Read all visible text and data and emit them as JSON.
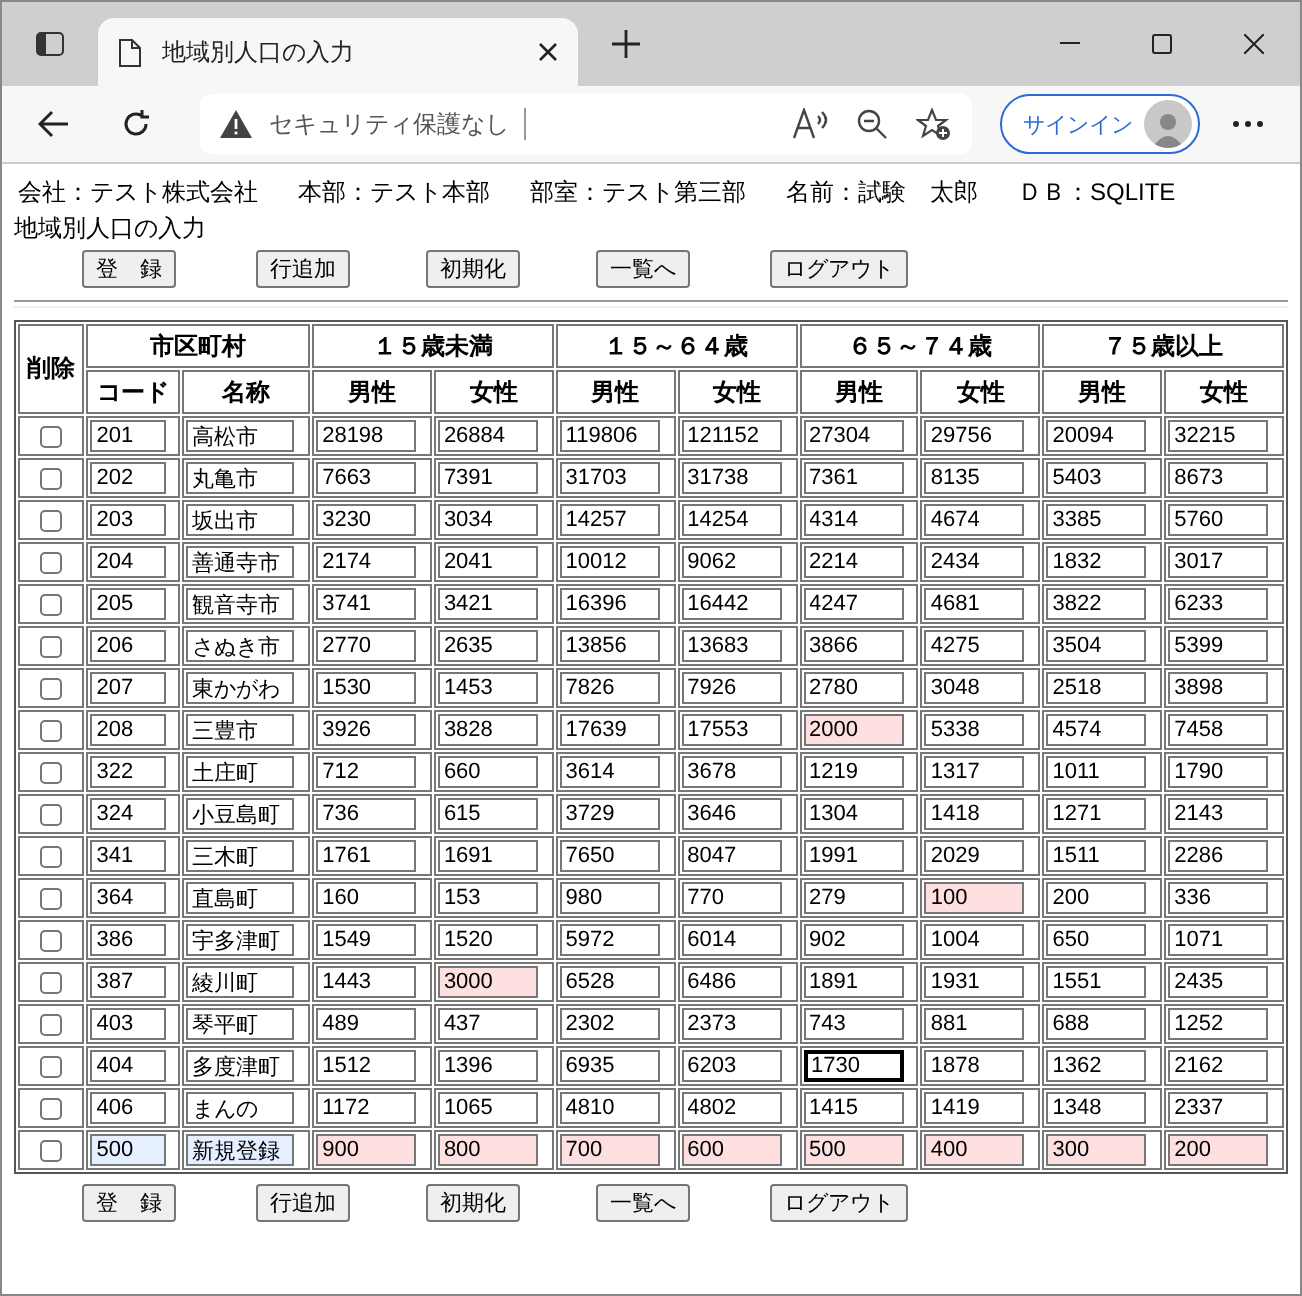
{
  "browser": {
    "tab_title": "地域別人口の入力",
    "security": "セキュリティ保護なし",
    "signin": "サインイン"
  },
  "info": [
    {
      "label": "会社：テスト株式会社"
    },
    {
      "label": "本部：テスト本部"
    },
    {
      "label": "部室：テスト第三部"
    },
    {
      "label": "名前：試験　太郎"
    },
    {
      "label": "ＤＢ：SQLITE"
    }
  ],
  "page_title": "地域別人口の入力",
  "buttons": [
    "登　録",
    "行追加",
    "初期化",
    "一覧へ",
    "ログアウト"
  ],
  "table": {
    "delete_header": "削除",
    "groups": [
      "市区町村",
      "１５歳未満",
      "１５～６４歳",
      "６５～７４歳",
      "７５歳以上"
    ],
    "subheaders": [
      "コード",
      "名称",
      "男性",
      "女性",
      "男性",
      "女性",
      "男性",
      "女性",
      "男性",
      "女性"
    ],
    "rows": [
      {
        "kind": "existing",
        "checked": false,
        "code": "201",
        "name": "高松市",
        "values": [
          {
            "value": "28198",
            "changed": false,
            "focused": false
          },
          {
            "value": "26884",
            "changed": false,
            "focused": false
          },
          {
            "value": "119806",
            "changed": false,
            "focused": false
          },
          {
            "value": "121152",
            "changed": false,
            "focused": false
          },
          {
            "value": "27304",
            "changed": false,
            "focused": false
          },
          {
            "value": "29756",
            "changed": false,
            "focused": false
          },
          {
            "value": "20094",
            "changed": false,
            "focused": false
          },
          {
            "value": "32215",
            "changed": false,
            "focused": false
          }
        ]
      },
      {
        "kind": "existing",
        "checked": false,
        "code": "202",
        "name": "丸亀市",
        "values": [
          {
            "value": "7663",
            "changed": false,
            "focused": false
          },
          {
            "value": "7391",
            "changed": false,
            "focused": false
          },
          {
            "value": "31703",
            "changed": false,
            "focused": false
          },
          {
            "value": "31738",
            "changed": false,
            "focused": false
          },
          {
            "value": "7361",
            "changed": false,
            "focused": false
          },
          {
            "value": "8135",
            "changed": false,
            "focused": false
          },
          {
            "value": "5403",
            "changed": false,
            "focused": false
          },
          {
            "value": "8673",
            "changed": false,
            "focused": false
          }
        ]
      },
      {
        "kind": "existing",
        "checked": false,
        "code": "203",
        "name": "坂出市",
        "values": [
          {
            "value": "3230",
            "changed": false,
            "focused": false
          },
          {
            "value": "3034",
            "changed": false,
            "focused": false
          },
          {
            "value": "14257",
            "changed": false,
            "focused": false
          },
          {
            "value": "14254",
            "changed": false,
            "focused": false
          },
          {
            "value": "4314",
            "changed": false,
            "focused": false
          },
          {
            "value": "4674",
            "changed": false,
            "focused": false
          },
          {
            "value": "3385",
            "changed": false,
            "focused": false
          },
          {
            "value": "5760",
            "changed": false,
            "focused": false
          }
        ]
      },
      {
        "kind": "existing",
        "checked": false,
        "code": "204",
        "name": "善通寺市",
        "values": [
          {
            "value": "2174",
            "changed": false,
            "focused": false
          },
          {
            "value": "2041",
            "changed": false,
            "focused": false
          },
          {
            "value": "10012",
            "changed": false,
            "focused": false
          },
          {
            "value": "9062",
            "changed": false,
            "focused": false
          },
          {
            "value": "2214",
            "changed": false,
            "focused": false
          },
          {
            "value": "2434",
            "changed": false,
            "focused": false
          },
          {
            "value": "1832",
            "changed": false,
            "focused": false
          },
          {
            "value": "3017",
            "changed": false,
            "focused": false
          }
        ]
      },
      {
        "kind": "existing",
        "checked": false,
        "code": "205",
        "name": "観音寺市",
        "values": [
          {
            "value": "3741",
            "changed": false,
            "focused": false
          },
          {
            "value": "3421",
            "changed": false,
            "focused": false
          },
          {
            "value": "16396",
            "changed": false,
            "focused": false
          },
          {
            "value": "16442",
            "changed": false,
            "focused": false
          },
          {
            "value": "4247",
            "changed": false,
            "focused": false
          },
          {
            "value": "4681",
            "changed": false,
            "focused": false
          },
          {
            "value": "3822",
            "changed": false,
            "focused": false
          },
          {
            "value": "6233",
            "changed": false,
            "focused": false
          }
        ]
      },
      {
        "kind": "existing",
        "checked": false,
        "code": "206",
        "name": "さぬき市",
        "values": [
          {
            "value": "2770",
            "changed": false,
            "focused": false
          },
          {
            "value": "2635",
            "changed": false,
            "focused": false
          },
          {
            "value": "13856",
            "changed": false,
            "focused": false
          },
          {
            "value": "13683",
            "changed": false,
            "focused": false
          },
          {
            "value": "3866",
            "changed": false,
            "focused": false
          },
          {
            "value": "4275",
            "changed": false,
            "focused": false
          },
          {
            "value": "3504",
            "changed": false,
            "focused": false
          },
          {
            "value": "5399",
            "changed": false,
            "focused": false
          }
        ]
      },
      {
        "kind": "existing",
        "checked": false,
        "code": "207",
        "name": "東かがわ",
        "values": [
          {
            "value": "1530",
            "changed": false,
            "focused": false
          },
          {
            "value": "1453",
            "changed": false,
            "focused": false
          },
          {
            "value": "7826",
            "changed": false,
            "focused": false
          },
          {
            "value": "7926",
            "changed": false,
            "focused": false
          },
          {
            "value": "2780",
            "changed": false,
            "focused": false
          },
          {
            "value": "3048",
            "changed": false,
            "focused": false
          },
          {
            "value": "2518",
            "changed": false,
            "focused": false
          },
          {
            "value": "3898",
            "changed": false,
            "focused": false
          }
        ]
      },
      {
        "kind": "existing",
        "checked": false,
        "code": "208",
        "name": "三豊市",
        "values": [
          {
            "value": "3926",
            "changed": false,
            "focused": false
          },
          {
            "value": "3828",
            "changed": false,
            "focused": false
          },
          {
            "value": "17639",
            "changed": false,
            "focused": false
          },
          {
            "value": "17553",
            "changed": false,
            "focused": false
          },
          {
            "value": "2000",
            "changed": true,
            "focused": false
          },
          {
            "value": "5338",
            "changed": false,
            "focused": false
          },
          {
            "value": "4574",
            "changed": false,
            "focused": false
          },
          {
            "value": "7458",
            "changed": false,
            "focused": false
          }
        ]
      },
      {
        "kind": "existing",
        "checked": false,
        "code": "322",
        "name": "土庄町",
        "values": [
          {
            "value": "712",
            "changed": false,
            "focused": false
          },
          {
            "value": "660",
            "changed": false,
            "focused": false
          },
          {
            "value": "3614",
            "changed": false,
            "focused": false
          },
          {
            "value": "3678",
            "changed": false,
            "focused": false
          },
          {
            "value": "1219",
            "changed": false,
            "focused": false
          },
          {
            "value": "1317",
            "changed": false,
            "focused": false
          },
          {
            "value": "1011",
            "changed": false,
            "focused": false
          },
          {
            "value": "1790",
            "changed": false,
            "focused": false
          }
        ]
      },
      {
        "kind": "existing",
        "checked": false,
        "code": "324",
        "name": "小豆島町",
        "values": [
          {
            "value": "736",
            "changed": false,
            "focused": false
          },
          {
            "value": "615",
            "changed": false,
            "focused": false
          },
          {
            "value": "3729",
            "changed": false,
            "focused": false
          },
          {
            "value": "3646",
            "changed": false,
            "focused": false
          },
          {
            "value": "1304",
            "changed": false,
            "focused": false
          },
          {
            "value": "1418",
            "changed": false,
            "focused": false
          },
          {
            "value": "1271",
            "changed": false,
            "focused": false
          },
          {
            "value": "2143",
            "changed": false,
            "focused": false
          }
        ]
      },
      {
        "kind": "existing",
        "checked": false,
        "code": "341",
        "name": "三木町",
        "values": [
          {
            "value": "1761",
            "changed": false,
            "focused": false
          },
          {
            "value": "1691",
            "changed": false,
            "focused": false
          },
          {
            "value": "7650",
            "changed": false,
            "focused": false
          },
          {
            "value": "8047",
            "changed": false,
            "focused": false
          },
          {
            "value": "1991",
            "changed": false,
            "focused": false
          },
          {
            "value": "2029",
            "changed": false,
            "focused": false
          },
          {
            "value": "1511",
            "changed": false,
            "focused": false
          },
          {
            "value": "2286",
            "changed": false,
            "focused": false
          }
        ]
      },
      {
        "kind": "existing",
        "checked": false,
        "code": "364",
        "name": "直島町",
        "values": [
          {
            "value": "160",
            "changed": false,
            "focused": false
          },
          {
            "value": "153",
            "changed": false,
            "focused": false
          },
          {
            "value": "980",
            "changed": false,
            "focused": false
          },
          {
            "value": "770",
            "changed": false,
            "focused": false
          },
          {
            "value": "279",
            "changed": false,
            "focused": false
          },
          {
            "value": "100",
            "changed": true,
            "focused": false
          },
          {
            "value": "200",
            "changed": false,
            "focused": false
          },
          {
            "value": "336",
            "changed": false,
            "focused": false
          }
        ]
      },
      {
        "kind": "existing",
        "checked": false,
        "code": "386",
        "name": "宇多津町",
        "values": [
          {
            "value": "1549",
            "changed": false,
            "focused": false
          },
          {
            "value": "1520",
            "changed": false,
            "focused": false
          },
          {
            "value": "5972",
            "changed": false,
            "focused": false
          },
          {
            "value": "6014",
            "changed": false,
            "focused": false
          },
          {
            "value": "902",
            "changed": false,
            "focused": false
          },
          {
            "value": "1004",
            "changed": false,
            "focused": false
          },
          {
            "value": "650",
            "changed": false,
            "focused": false
          },
          {
            "value": "1071",
            "changed": false,
            "focused": false
          }
        ]
      },
      {
        "kind": "existing",
        "checked": false,
        "code": "387",
        "name": "綾川町",
        "values": [
          {
            "value": "1443",
            "changed": false,
            "focused": false
          },
          {
            "value": "3000",
            "changed": true,
            "focused": false
          },
          {
            "value": "6528",
            "changed": false,
            "focused": false
          },
          {
            "value": "6486",
            "changed": false,
            "focused": false
          },
          {
            "value": "1891",
            "changed": false,
            "focused": false
          },
          {
            "value": "1931",
            "changed": false,
            "focused": false
          },
          {
            "value": "1551",
            "changed": false,
            "focused": false
          },
          {
            "value": "2435",
            "changed": false,
            "focused": false
          }
        ]
      },
      {
        "kind": "existing",
        "checked": false,
        "code": "403",
        "name": "琴平町",
        "values": [
          {
            "value": "489",
            "changed": false,
            "focused": false
          },
          {
            "value": "437",
            "changed": false,
            "focused": false
          },
          {
            "value": "2302",
            "changed": false,
            "focused": false
          },
          {
            "value": "2373",
            "changed": false,
            "focused": false
          },
          {
            "value": "743",
            "changed": false,
            "focused": false
          },
          {
            "value": "881",
            "changed": false,
            "focused": false
          },
          {
            "value": "688",
            "changed": false,
            "focused": false
          },
          {
            "value": "1252",
            "changed": false,
            "focused": false
          }
        ]
      },
      {
        "kind": "existing",
        "checked": false,
        "code": "404",
        "name": "多度津町",
        "values": [
          {
            "value": "1512",
            "changed": false,
            "focused": false
          },
          {
            "value": "1396",
            "changed": false,
            "focused": false
          },
          {
            "value": "6935",
            "changed": false,
            "focused": false
          },
          {
            "value": "6203",
            "changed": false,
            "focused": false
          },
          {
            "value": "1730",
            "changed": false,
            "focused": true
          },
          {
            "value": "1878",
            "changed": false,
            "focused": false
          },
          {
            "value": "1362",
            "changed": false,
            "focused": false
          },
          {
            "value": "2162",
            "changed": false,
            "focused": false
          }
        ]
      },
      {
        "kind": "existing",
        "checked": false,
        "code": "406",
        "name": "まんの",
        "values": [
          {
            "value": "1172",
            "changed": false,
            "focused": false
          },
          {
            "value": "1065",
            "changed": false,
            "focused": false
          },
          {
            "value": "4810",
            "changed": false,
            "focused": false
          },
          {
            "value": "4802",
            "changed": false,
            "focused": false
          },
          {
            "value": "1415",
            "changed": false,
            "focused": false
          },
          {
            "value": "1419",
            "changed": false,
            "focused": false
          },
          {
            "value": "1348",
            "changed": false,
            "focused": false
          },
          {
            "value": "2337",
            "changed": false,
            "focused": false
          }
        ]
      },
      {
        "kind": "new",
        "checked": false,
        "code": "500",
        "name": "新規登録",
        "values": [
          {
            "value": "900",
            "changed": true,
            "focused": false
          },
          {
            "value": "800",
            "changed": true,
            "focused": false
          },
          {
            "value": "700",
            "changed": true,
            "focused": false
          },
          {
            "value": "600",
            "changed": true,
            "focused": false
          },
          {
            "value": "500",
            "changed": true,
            "focused": false
          },
          {
            "value": "400",
            "changed": true,
            "focused": false
          },
          {
            "value": "300",
            "changed": true,
            "focused": false
          },
          {
            "value": "200",
            "changed": true,
            "focused": false
          }
        ]
      }
    ]
  },
  "bottom_buttons": [
    "登　録",
    "行追加",
    "初期化",
    "一覧へ",
    "ログアウト"
  ]
}
